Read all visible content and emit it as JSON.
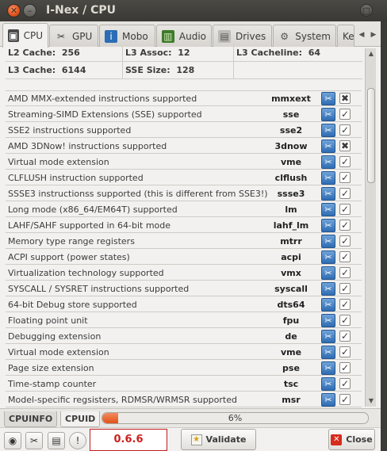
{
  "window": {
    "title": "I-Nex / CPU"
  },
  "tabs": [
    {
      "label": "CPU",
      "icon": "cpu-icon",
      "color": "#4a4a4a"
    },
    {
      "label": "GPU",
      "icon": "tools-icon",
      "color": "#3c3c3c"
    },
    {
      "label": "Mobo",
      "icon": "info-icon",
      "color": "#2a6db5"
    },
    {
      "label": "Audio",
      "icon": "memory-icon",
      "color": "#3e7b2a"
    },
    {
      "label": "Drives",
      "icon": "drive-icon",
      "color": "#777777"
    },
    {
      "label": "System",
      "icon": "settings-icon",
      "color": "#555555"
    },
    {
      "label": "Ke",
      "icon": "",
      "color": "#3c3c3c"
    }
  ],
  "cache": {
    "row1": [
      {
        "label": "L2 Cache:",
        "value": "256"
      },
      {
        "label": "L3 Assoc:",
        "value": "12"
      },
      {
        "label": "L3 Cacheline:",
        "value": "64"
      }
    ],
    "row2": [
      {
        "label": "L3 Cache:",
        "value": "6144"
      },
      {
        "label": "SSE Size:",
        "value": "128"
      }
    ]
  },
  "instructions": [
    {
      "desc": "AMD MMX-extended instructions supported",
      "flag": "mmxext",
      "supported": false
    },
    {
      "desc": "Streaming-SIMD Extensions (SSE) supported",
      "flag": "sse",
      "supported": true
    },
    {
      "desc": "SSE2 instructions supported",
      "flag": "sse2",
      "supported": true
    },
    {
      "desc": "AMD 3DNow! instructions supported",
      "flag": "3dnow",
      "supported": false
    },
    {
      "desc": "Virtual mode extension",
      "flag": "vme",
      "supported": true
    },
    {
      "desc": "CLFLUSH instruction supported",
      "flag": "clflush",
      "supported": true
    },
    {
      "desc": "SSSE3 instructionss supported (this is different from SSE3!)",
      "flag": "ssse3",
      "supported": true
    },
    {
      "desc": "Long mode (x86_64/EM64T) supported",
      "flag": "lm",
      "supported": true
    },
    {
      "desc": "LAHF/SAHF supported in 64-bit mode",
      "flag": "lahf_lm",
      "supported": true
    },
    {
      "desc": "Memory type range registers",
      "flag": "mtrr",
      "supported": true
    },
    {
      "desc": "ACPI support (power states)",
      "flag": "acpi",
      "supported": true
    },
    {
      "desc": "Virtualization technology supported",
      "flag": "vmx",
      "supported": true
    },
    {
      "desc": "SYSCALL / SYSRET instructions supported",
      "flag": "syscall",
      "supported": true
    },
    {
      "desc": "64-bit Debug store supported",
      "flag": "dts64",
      "supported": true
    },
    {
      "desc": "Floating point unit",
      "flag": "fpu",
      "supported": true
    },
    {
      "desc": "Debugging extension",
      "flag": "de",
      "supported": true
    },
    {
      "desc": "Virtual mode extension",
      "flag": "vme",
      "supported": true
    },
    {
      "desc": "Page size extension",
      "flag": "pse",
      "supported": true
    },
    {
      "desc": "Time-stamp counter",
      "flag": "tsc",
      "supported": true
    },
    {
      "desc": "Model-specific regsisters, RDMSR/WRMSR supported",
      "flag": "msr",
      "supported": true
    }
  ],
  "bottom_tabs": [
    {
      "label": "CPUINFO"
    },
    {
      "label": "CPUID"
    }
  ],
  "progress": {
    "text": "6%",
    "fraction": 0.06
  },
  "toolbar": {
    "version": "0.6.6",
    "validate_label": "Validate",
    "close_label": "Close",
    "accent_color": "#cc1f1f"
  }
}
